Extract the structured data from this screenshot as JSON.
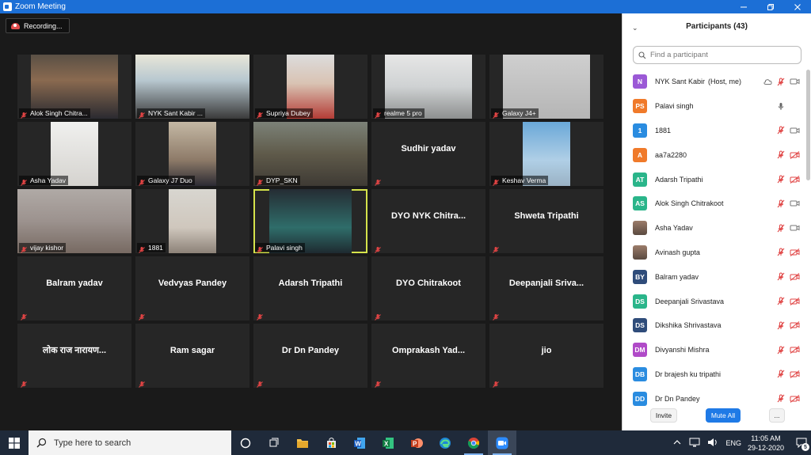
{
  "window": {
    "title": "Zoom Meeting",
    "controls": [
      "minimize",
      "restore",
      "close"
    ]
  },
  "recording": {
    "label": "Recording..."
  },
  "video_tiles": [
    {
      "name": "Alok Singh Chitra...",
      "video": true,
      "cam": "c1"
    },
    {
      "name": "NYK Sant Kabir ...",
      "video": true,
      "cam": "c2"
    },
    {
      "name": "Supriya Dubey",
      "video": true,
      "cam": "c3"
    },
    {
      "name": "realme 5 pro",
      "video": true,
      "cam": "c4"
    },
    {
      "name": "Galaxy J4+",
      "video": true,
      "cam": "c5"
    },
    {
      "name": "Asha Yadav",
      "video": true,
      "cam": "c6"
    },
    {
      "name": "Galaxy J7 Duo",
      "video": true,
      "cam": "c7"
    },
    {
      "name": "DYP_SKN",
      "video": true,
      "cam": "c8"
    },
    {
      "name": "Sudhir yadav",
      "video": false
    },
    {
      "name": "Keshav Verma",
      "video": true,
      "cam": "c9"
    },
    {
      "name": "vijay kishor",
      "video": true,
      "cam": "c10"
    },
    {
      "name": "1881",
      "video": true,
      "cam": "c11"
    },
    {
      "name": "Palavi singh",
      "video": true,
      "cam": "c12",
      "active_speaker": true
    },
    {
      "name": "DYO NYK Chitra...",
      "video": false
    },
    {
      "name": "Shweta Tripathi",
      "video": false
    },
    {
      "name": "Balram yadav",
      "video": false
    },
    {
      "name": "Vedvyas Pandey",
      "video": false
    },
    {
      "name": "Adarsh Tripathi",
      "video": false
    },
    {
      "name": "DYO Chitrakoot",
      "video": false
    },
    {
      "name": "Deepanjali  Sriva...",
      "video": false
    },
    {
      "name": "लोक राज नारायण...",
      "video": false
    },
    {
      "name": "Ram sagar",
      "video": false
    },
    {
      "name": "Dr Dn Pandey",
      "video": false
    },
    {
      "name": "Omprakash  Yad...",
      "video": false
    },
    {
      "name": "jio",
      "video": false
    }
  ],
  "participants_panel": {
    "title": "Participants (43)",
    "search_placeholder": "Find a participant",
    "participants": [
      {
        "initials": "N",
        "color": "#9b59d6",
        "name": "NYK Sant Kabir",
        "tag": "(Host, me)",
        "mic": "muted",
        "video": "on",
        "cloud": true
      },
      {
        "initials": "PS",
        "color": "#f07a2a",
        "name": "Palavi singh",
        "mic": "on",
        "video": "none"
      },
      {
        "initials": "1",
        "color": "#2a8ce0",
        "name": "1881",
        "mic": "muted",
        "video": "on"
      },
      {
        "initials": "A",
        "color": "#f07a2a",
        "name": "aa7a2280",
        "mic": "muted",
        "video": "off"
      },
      {
        "initials": "AT",
        "color": "#2ab58a",
        "name": "Adarsh Tripathi",
        "mic": "muted",
        "video": "off"
      },
      {
        "initials": "AS",
        "color": "#2ab58a",
        "name": "Alok Singh Chitrakoot",
        "mic": "muted",
        "video": "on"
      },
      {
        "initials": "",
        "color": "#8a6a5a",
        "name": "Asha Yadav",
        "mic": "muted",
        "video": "on",
        "photo": true
      },
      {
        "initials": "",
        "color": "#b08a70",
        "name": "Avinash gupta",
        "mic": "muted",
        "video": "off",
        "photo": true
      },
      {
        "initials": "BY",
        "color": "#2f4c7a",
        "name": "Balram yadav",
        "mic": "muted",
        "video": "off"
      },
      {
        "initials": "DS",
        "color": "#2ab58a",
        "name": "Deepanjali Srivastava",
        "mic": "muted",
        "video": "off"
      },
      {
        "initials": "DS",
        "color": "#2f4c7a",
        "name": "Dikshika Shrivastava",
        "mic": "muted",
        "video": "off"
      },
      {
        "initials": "DM",
        "color": "#b04ac8",
        "name": "Divyanshi Mishra",
        "mic": "muted",
        "video": "off"
      },
      {
        "initials": "DB",
        "color": "#2a8ce0",
        "name": "Dr brajesh ku tripathi",
        "mic": "muted",
        "video": "off"
      },
      {
        "initials": "DD",
        "color": "#2a8ce0",
        "name": "Dr Dn Pandey",
        "mic": "muted",
        "video": "off"
      }
    ],
    "invite_label": "Invite",
    "mute_all_label": "Mute All",
    "more_label": "..."
  },
  "taskbar": {
    "search_placeholder": "Type here to search",
    "apps": [
      "cortana-icon",
      "task-view-icon",
      "file-explorer-icon",
      "store-icon",
      "word-icon",
      "excel-icon",
      "powerpoint-icon",
      "edge-icon",
      "chrome-icon",
      "zoom-icon"
    ],
    "language": "ENG",
    "time": "11:05 AM",
    "date": "29-12-2020",
    "notifications": "5"
  }
}
